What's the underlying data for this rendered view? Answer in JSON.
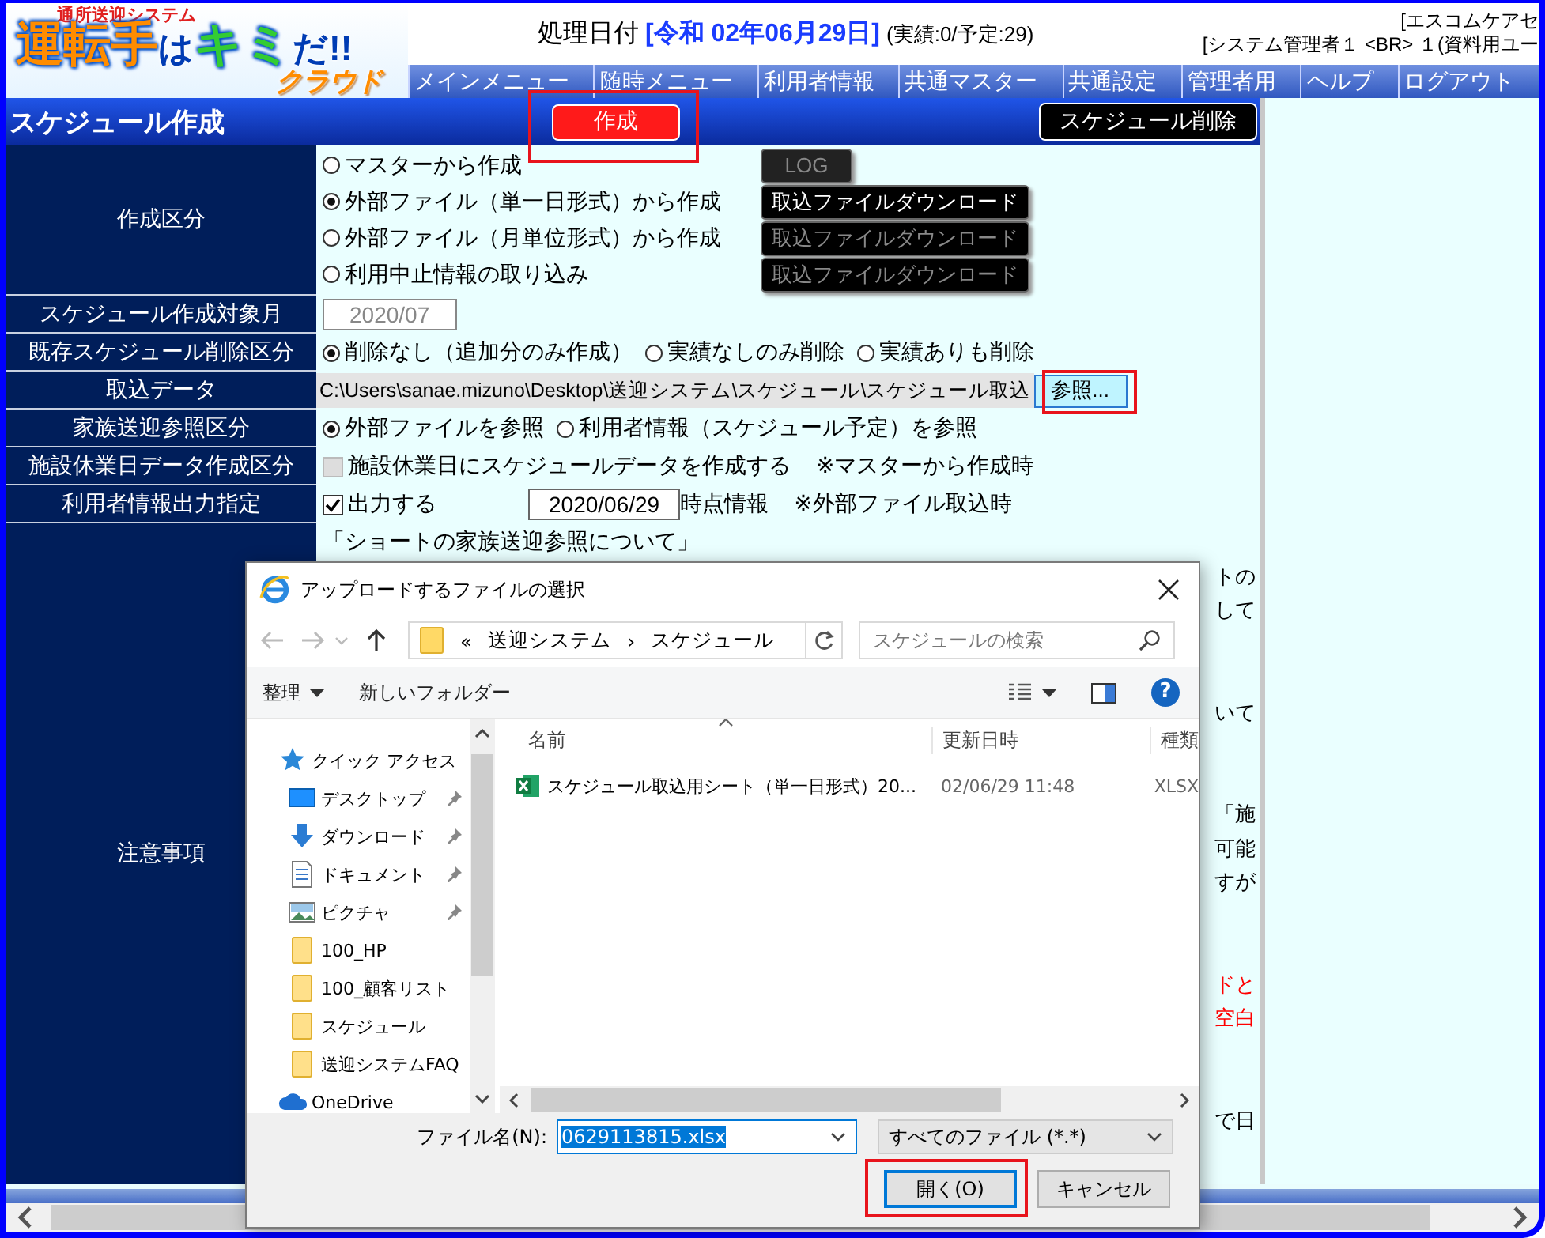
{
  "logo": {
    "tagline": "通所送迎システム",
    "title_parts": [
      "運転手",
      "は",
      "キミ",
      "だ!!"
    ],
    "subtitle": "クラウド"
  },
  "header": {
    "date_label": "処理日付",
    "date_value": "[令和 02年06月29日]",
    "counts": "(実績:0/予定:29)",
    "organization": "[エスコムケアセ",
    "user": "[システム管理者１ <BR> １(資料用ユー"
  },
  "menu": [
    "メインメニュー",
    "随時メニュー",
    "利用者情報",
    "共通マスター",
    "共通設定",
    "管理者用",
    "ヘルプ",
    "ログアウト"
  ],
  "title_bar": {
    "title": "スケジュール作成",
    "create_button": {
      "label": "作成",
      "highlighted": true
    },
    "delete_button": {
      "label": "スケジュール削除"
    }
  },
  "form": [
    {
      "kind": "choice_list",
      "label": "作成区分",
      "options": [
        {
          "label": "マスターから作成",
          "selected": false,
          "button": {
            "label": "LOG",
            "disabled": true
          }
        },
        {
          "label": "外部ファイル（単一日形式）から作成",
          "selected": true,
          "button": {
            "label": "取込ファイルダウンロード",
            "disabled": false
          }
        },
        {
          "label": "外部ファイル（月単位形式）から作成",
          "selected": false,
          "button": {
            "label": "取込ファイルダウンロード",
            "disabled": true
          }
        },
        {
          "label": "利用中止情報の取り込み",
          "selected": false,
          "button": {
            "label": "取込ファイルダウンロード",
            "disabled": true
          }
        }
      ]
    },
    {
      "kind": "field",
      "label": "スケジュール作成対象月",
      "value": "2020/07",
      "disabled": true
    },
    {
      "kind": "radios",
      "label": "既存スケジュール削除区分",
      "options": [
        {
          "label": "削除なし（追加分のみ作成）",
          "selected": true
        },
        {
          "label": "実績なしのみ削除",
          "selected": false
        },
        {
          "label": "実績ありも削除",
          "selected": false
        }
      ]
    },
    {
      "kind": "file",
      "label": "取込データ",
      "path": "C:\\Users\\sanae.mizuno\\Desktop\\送迎システム\\スケジュール\\スケジュール取込",
      "button": {
        "label": "参照...",
        "highlighted": true
      }
    },
    {
      "kind": "radios",
      "label": "家族送迎参照区分",
      "options": [
        {
          "label": "外部ファイルを参照",
          "selected": true
        },
        {
          "label": "利用者情報（スケジュール予定）を参照",
          "selected": false
        }
      ]
    },
    {
      "kind": "checkbox",
      "label": "施設休業日データ作成区分",
      "checked": false,
      "disabled": true,
      "text": "施設休業日にスケジュールデータを作成する",
      "note": "※マスターから作成時"
    },
    {
      "kind": "checkbox",
      "label": "利用者情報出力指定",
      "checked": true,
      "disabled": false,
      "text": "出力する",
      "date": "2020/06/29",
      "suffix": "時点情報",
      "note": "※外部ファイル取込時"
    },
    {
      "kind": "notes",
      "label": "注意事項",
      "heading": "「ショートの家族送迎参照について」",
      "paragraphs": [
        {
          "lines": [
            {
              "text": "トの",
              "kind": "normal"
            },
            {
              "text": "して",
              "kind": "normal"
            }
          ]
        },
        {
          "lines": [
            {
              "text": "いて",
              "kind": "normal"
            }
          ]
        },
        {
          "lines": [
            {
              "text": "「施",
              "kind": "normal"
            },
            {
              "text": "可能",
              "kind": "normal"
            },
            {
              "text": "すが",
              "kind": "normal"
            }
          ]
        },
        {
          "lines": [
            {
              "text": "ドと",
              "kind": "warning"
            },
            {
              "text": "空白",
              "kind": "warning"
            }
          ]
        },
        {
          "lines": [
            {
              "text": "で日",
              "kind": "normal"
            }
          ]
        }
      ]
    }
  ],
  "dialog": {
    "title": "アップロードするファイルの選択",
    "address": {
      "overflow": "«",
      "segments": [
        "送迎システム",
        "スケジュール"
      ],
      "separator": "›"
    },
    "search_placeholder": "スケジュールの検索",
    "toolbar": {
      "organize": "整理",
      "new_folder": "新しいフォルダー",
      "help": "?"
    },
    "nav": [
      {
        "label": "クイック アクセス",
        "kind": "quick",
        "children": [
          {
            "label": "デスクトップ",
            "kind": "desktop",
            "pinned": true
          },
          {
            "label": "ダウンロード",
            "kind": "download",
            "pinned": true
          },
          {
            "label": "ドキュメント",
            "kind": "document",
            "pinned": true
          },
          {
            "label": "ピクチャ",
            "kind": "picture",
            "pinned": true
          },
          {
            "label": "100_HP",
            "kind": "folder",
            "pinned": false
          },
          {
            "label": "100_顧客リスト",
            "kind": "folder",
            "pinned": false
          },
          {
            "label": "スケジュール",
            "kind": "folder",
            "pinned": false
          },
          {
            "label": "送迎システムFAQ",
            "kind": "folder",
            "pinned": false
          }
        ]
      },
      {
        "label": "OneDrive",
        "kind": "cloud"
      }
    ],
    "columns": [
      "名前",
      "更新日時",
      "種類"
    ],
    "files": [
      {
        "name": "スケジュール取込用シート（単一日形式）20...",
        "modified": "02/06/29 11:48",
        "type": "XLSX"
      }
    ],
    "filename_label": "ファイル名(N):",
    "filename": "0629113815.xlsx",
    "filter": "すべてのファイル (*.*)",
    "open_button": {
      "label": "開く(O)",
      "highlighted": true
    },
    "cancel_button": "キャンセル"
  }
}
